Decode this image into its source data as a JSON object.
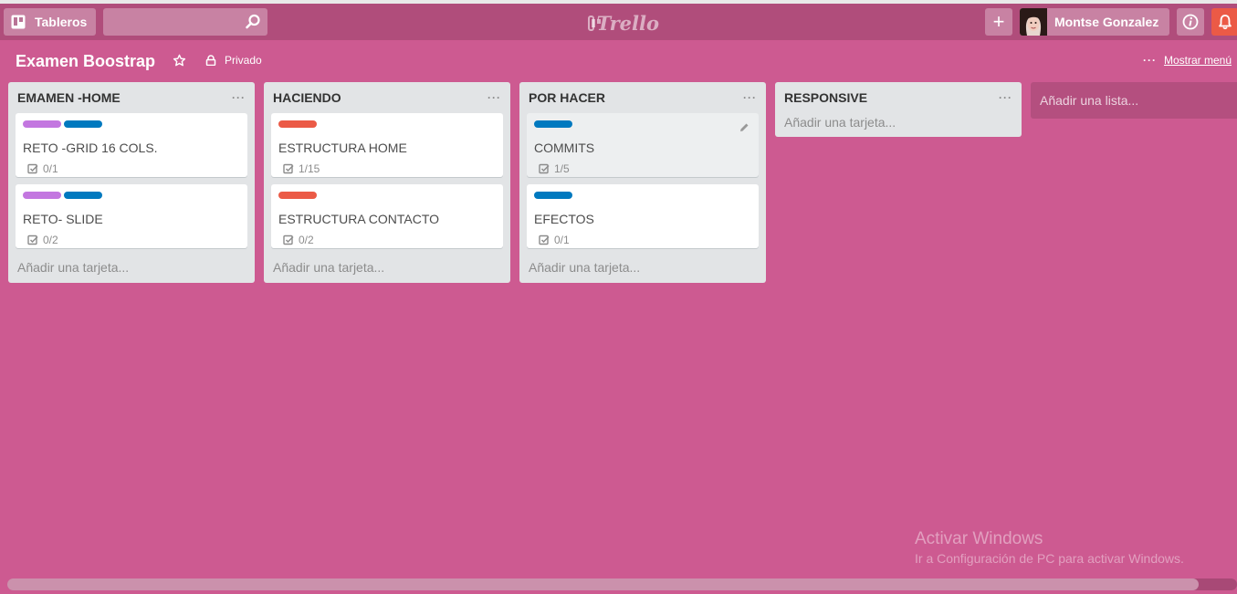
{
  "header": {
    "boards_label": "Tableros",
    "search_placeholder": "",
    "logo_text": "Trello",
    "add_label": "+",
    "user_name": "Montse Gonzalez",
    "notification_color": "#eb5a46"
  },
  "board": {
    "title": "Examen Boostrap",
    "visibility": "Privado",
    "menu_dots": "···",
    "menu_label": "Mostrar menú"
  },
  "colors": {
    "background": "#cd5a91",
    "header": "#b04d7b",
    "label_purple": "#c377e0",
    "label_blue": "#0079bf",
    "label_red": "#eb5a46"
  },
  "lists": [
    {
      "title": "EMAMEN -HOME",
      "more": "···",
      "add_card": "Añadir una tarjeta...",
      "cards": [
        {
          "title": "RETO -GRID 16 COLS.",
          "checklist": "0/1"
        },
        {
          "title": "RETO- SLIDE",
          "checklist": "0/2"
        }
      ]
    },
    {
      "title": "HACIENDO",
      "more": "···",
      "add_card": "Añadir una tarjeta...",
      "cards": [
        {
          "title": "ESTRUCTURA HOME",
          "checklist": "1/15"
        },
        {
          "title": "ESTRUCTURA CONTACTO",
          "checklist": "0/2"
        }
      ]
    },
    {
      "title": "POR HACER",
      "more": "···",
      "add_card": "Añadir una tarjeta...",
      "cards": [
        {
          "title": "COMMITS",
          "checklist": "1/5"
        },
        {
          "title": "EFECTOS",
          "checklist": "0/1"
        }
      ]
    },
    {
      "title": "RESPONSIVE",
      "more": "···",
      "add_card": "Añadir una tarjeta...",
      "cards": []
    }
  ],
  "add_list_label": "Añadir una lista...",
  "watermark": {
    "line1": "Activar Windows",
    "line2": "Ir a Configuración de PC para activar Windows."
  }
}
